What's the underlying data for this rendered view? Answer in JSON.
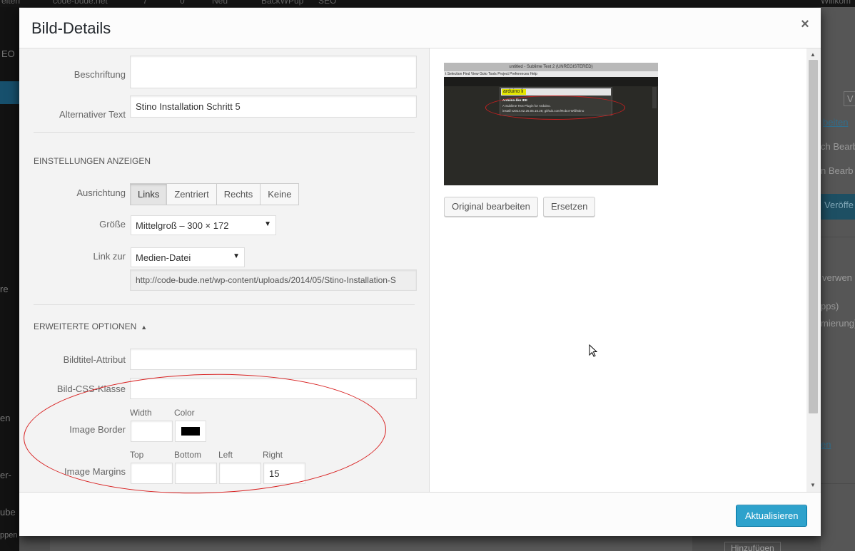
{
  "background": {
    "adminbar_items": [
      "eiten",
      "code-bude.net",
      "7",
      "0",
      "Neu",
      "BackWPup",
      "SEO",
      "Willkom"
    ],
    "sidemenu_fragments": [
      "EO",
      "re",
      "en",
      "er-",
      "ube",
      "ppen"
    ],
    "right_fragments": [
      "V",
      "beiten",
      "ch Bearb",
      "n Bearb",
      "Veröffe",
      "verwen",
      "pps)",
      "mierung)",
      "en",
      "Hinzufügen"
    ]
  },
  "modal": {
    "title": "Bild-Details",
    "close_symbol": "×",
    "fields": {
      "caption_label": "Beschriftung",
      "caption_value": "",
      "alt_label": "Alternativer Text",
      "alt_value": "Stino Installation Schritt 5"
    },
    "display_settings": {
      "heading": "EINSTELLUNGEN ANZEIGEN",
      "align_label": "Ausrichtung",
      "align_options": [
        "Links",
        "Zentriert",
        "Rechts",
        "Keine"
      ],
      "align_selected": "Links",
      "size_label": "Größe",
      "size_value": "Mittelgroß – 300 × 172",
      "link_label": "Link zur",
      "link_value": "Medien-Datei",
      "link_url": "http://code-bude.net/wp-content/uploads/2014/05/Stino-Installation-S"
    },
    "advanced": {
      "heading": "ERWEITERTE OPTIONEN",
      "title_attr_label": "Bildtitel-Attribut",
      "title_attr_value": "",
      "css_class_label": "Bild-CSS-Klasse",
      "css_class_value": "",
      "border_label": "Image Border",
      "border_width_label": "Width",
      "border_color_label": "Color",
      "border_width_value": "",
      "border_color_value": "#000000",
      "margins_label": "Image Margins",
      "margin_top_label": "Top",
      "margin_bottom_label": "Bottom",
      "margin_left_label": "Left",
      "margin_right_label": "Right",
      "margin_top_value": "",
      "margin_bottom_value": "",
      "margin_left_value": "",
      "margin_right_value": "15"
    },
    "preview": {
      "edit_original": "Original bearbeiten",
      "replace": "Ersetzen",
      "thumb_titlebar": "untitled - Sublime Text 2 (UNREGISTERED)",
      "thumb_menu": "t  Selection  Find  View  Goto  Tools  Project  Preferences  Help",
      "thumb_query": "arduino li",
      "thumb_result_1": "Arduino-like IDE",
      "thumb_result_2": "A Sublime Text Plugin for Arduino.",
      "thumb_result_3": "install v2014.02.25.05.15.28; github.com/Robot-Will/Stino"
    },
    "footer": {
      "update_button": "Aktualisieren"
    }
  }
}
